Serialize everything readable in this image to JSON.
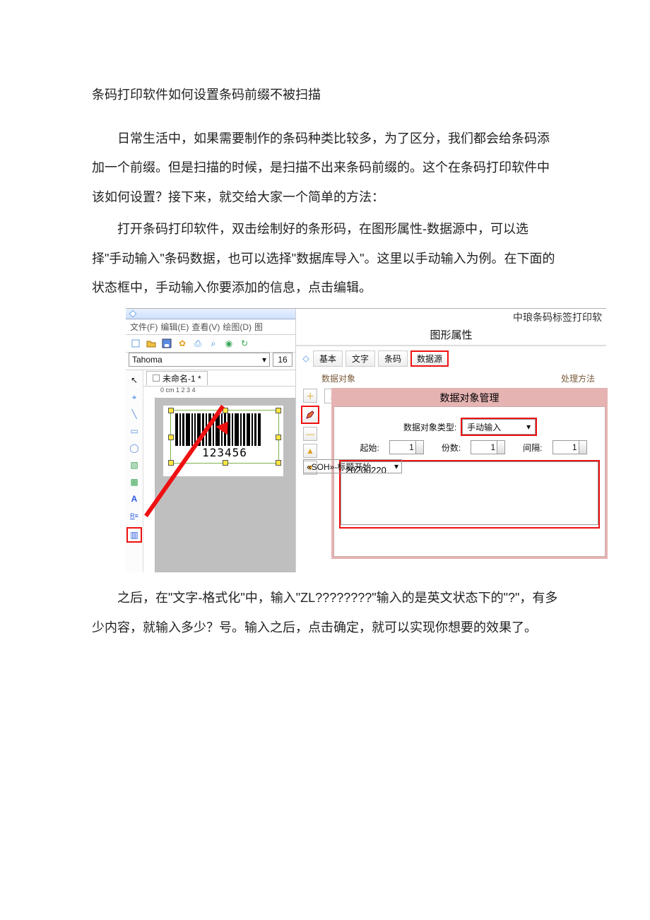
{
  "doc": {
    "title": "条码打印软件如何设置条码前缀不被扫描",
    "p1": "日常生活中，如果需要制作的条码种类比较多，为了区分，我们都会给条码添加一个前缀。但是扫描的时候，是扫描不出来条码前缀的。这个在条码打印软件中该如何设置？接下来，就交给大家一个简单的方法：",
    "p2": "打开条码打印软件，双击绘制好的条形码，在图形属性-数据源中，可以选择\"手动输入\"条码数据，也可以选择\"数据库导入\"。这里以手动输入为例。在下面的状态框中，手动输入你要添加的信息，点击编辑。",
    "p3": "之后，在\"文字-格式化\"中，输入\"ZL????????\"输入的是英文状态下的\"?\"，有多少内容，就输入多少？号。输入之后，点击确定，就可以实现你想要的效果了。"
  },
  "app": {
    "brand_title": "中琅条码标签打印软",
    "menus": {
      "file": "文件(F)",
      "edit": "编辑(E)",
      "view": "查看(V)",
      "draw": "绘图(D)",
      "more": "图"
    },
    "font_name": "Tahoma",
    "font_size": "16",
    "tab_name": "未命名-1 *",
    "ruler_text": "0 cm 1     2     3     4",
    "barcode_label": "123456"
  },
  "panel": {
    "title": "图形属性",
    "tabs": {
      "basic": "基本",
      "text": "文字",
      "barcode": "条码",
      "datasrc": "数据源"
    },
    "section_data": "数据对象",
    "section_proc": "处理方法",
    "data_value": "20200220",
    "type_select": "«SOH»-标题开始"
  },
  "modal": {
    "title": "数据对象管理",
    "type_label": "数据对象类型:",
    "type_value": "手动输入",
    "start_label": "起始:",
    "start_value": "1",
    "count_label": "份数:",
    "count_value": "1",
    "gap_label": "间隔:",
    "gap_value": "1",
    "text_value": "20200220"
  }
}
